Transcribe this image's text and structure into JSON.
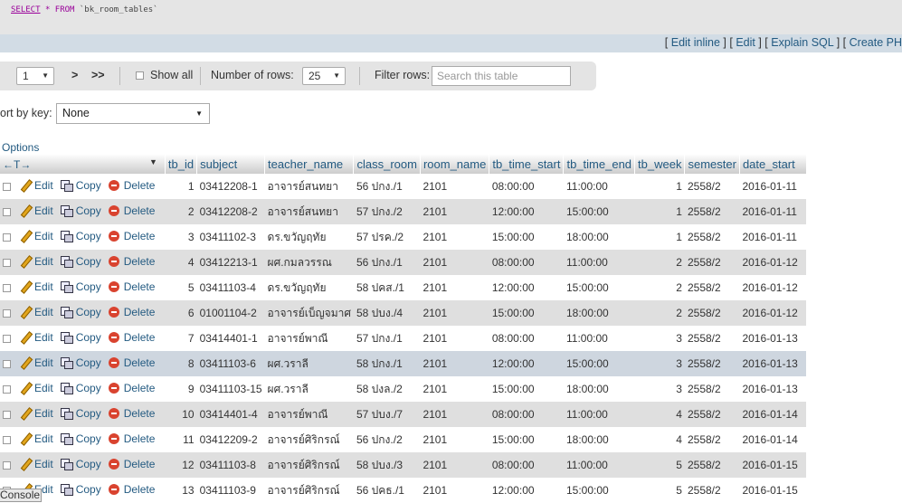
{
  "sql": {
    "kw_select": "SELECT",
    "rest": "* FROM",
    "table": "`bk_room_tables`"
  },
  "links": {
    "edit_inline": "Edit inline",
    "edit": "Edit",
    "explain_sql": "Explain SQL",
    "create_php": "Create PH"
  },
  "nav": {
    "page_value": "1",
    "next": ">",
    "last": ">>",
    "show_all": "Show all",
    "rows_label": "Number of rows:",
    "rows_value": "25",
    "filter_label": "Filter rows:",
    "filter_placeholder": "Search this table"
  },
  "sort": {
    "label": "ort by key:",
    "value": "None"
  },
  "options_label": "Options",
  "actions": {
    "edit": "Edit",
    "copy": "Copy",
    "delete": "Delete"
  },
  "columns": [
    "tb_id",
    "subject",
    "teacher_name",
    "class_room",
    "room_name",
    "tb_time_start",
    "tb_time_end",
    "tb_week",
    "semester",
    "date_start"
  ],
  "rows": [
    [
      "1",
      "03412208-1",
      "อาจารย์สนทยา",
      "56 ปกง./1",
      "2101",
      "08:00:00",
      "11:00:00",
      "1",
      "2558/2",
      "2016-01-11"
    ],
    [
      "2",
      "03412208-2",
      "อาจารย์สนทยา",
      "57 ปกง./2",
      "2101",
      "12:00:00",
      "15:00:00",
      "1",
      "2558/2",
      "2016-01-11"
    ],
    [
      "3",
      "03411102-3",
      "ดร.ขวัญฤทัย",
      "57 ปรค./2",
      "2101",
      "15:00:00",
      "18:00:00",
      "1",
      "2558/2",
      "2016-01-11"
    ],
    [
      "4",
      "03412213-1",
      "ผศ.กมลวรรณ",
      "56 ปกง./1",
      "2101",
      "08:00:00",
      "11:00:00",
      "2",
      "2558/2",
      "2016-01-12"
    ],
    [
      "5",
      "03411103-4",
      "ดร.ขวัญฤทัย",
      "58 ปคส./1",
      "2101",
      "12:00:00",
      "15:00:00",
      "2",
      "2558/2",
      "2016-01-12"
    ],
    [
      "6",
      "01001104-2",
      "อาจารย์เบ็ญจมาศ",
      "58 ปบง./4",
      "2101",
      "15:00:00",
      "18:00:00",
      "2",
      "2558/2",
      "2016-01-12"
    ],
    [
      "7",
      "03414401-1",
      "อาจารย์พาณี",
      "57 ปกง./1",
      "2101",
      "08:00:00",
      "11:00:00",
      "3",
      "2558/2",
      "2016-01-13"
    ],
    [
      "8",
      "03411103-6",
      "ผศ.วราลี",
      "58 ปกง./1",
      "2101",
      "12:00:00",
      "15:00:00",
      "3",
      "2558/2",
      "2016-01-13"
    ],
    [
      "9",
      "03411103-15",
      "ผศ.วราลี",
      "58 ปงล./2",
      "2101",
      "15:00:00",
      "18:00:00",
      "3",
      "2558/2",
      "2016-01-13"
    ],
    [
      "10",
      "03414401-4",
      "อาจารย์พาณี",
      "57 ปบง./7",
      "2101",
      "08:00:00",
      "11:00:00",
      "4",
      "2558/2",
      "2016-01-14"
    ],
    [
      "11",
      "03412209-2",
      "อาจารย์ศิริกรณ์",
      "56 ปกง./2",
      "2101",
      "15:00:00",
      "18:00:00",
      "4",
      "2558/2",
      "2016-01-14"
    ],
    [
      "12",
      "03411103-8",
      "อาจารย์ศิริกรณ์",
      "58 ปบง./3",
      "2101",
      "08:00:00",
      "11:00:00",
      "5",
      "2558/2",
      "2016-01-15"
    ],
    [
      "13",
      "03411103-9",
      "อาจารย์ศิริกรณ์",
      "56 ปคธ./1",
      "2101",
      "12:00:00",
      "15:00:00",
      "5",
      "2558/2",
      "2016-01-15"
    ]
  ],
  "highlight_row": 8,
  "console_label": "Console"
}
